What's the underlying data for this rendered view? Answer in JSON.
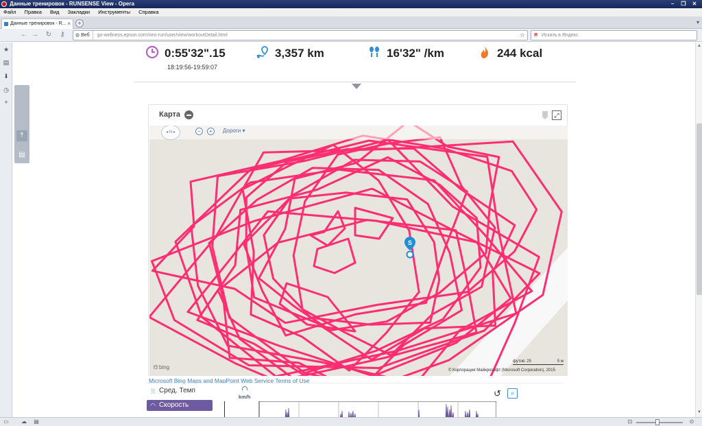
{
  "window": {
    "title": "Данные тренировок - RUNSENSE View - Opera",
    "controls": {
      "minimize": "–",
      "restore": "❐",
      "close": "✕"
    }
  },
  "menu": [
    "Файл",
    "Правка",
    "Вид",
    "Закладки",
    "Инструменты",
    "Справка"
  ],
  "tab": {
    "label": "Данные тренировок - R...",
    "close": "×",
    "new_tab": "+"
  },
  "address": {
    "site_label": "Веб",
    "url": "go-wellness.epson.com/neo-run/user/view/workoutDetail.html",
    "search_placeholder": "Искать в Яндекс",
    "search_engine": "Я"
  },
  "stats": {
    "time": "0:55'32\".15",
    "time_range": "18:19:56-19:59:07",
    "distance": "3,357 km",
    "pace": "16'32\" /km",
    "calories": "244 kcal"
  },
  "colors": {
    "time": "#b85fc6",
    "distance": "#2f8fd6",
    "pace": "#2f8fd6",
    "calories": "#f07a2a",
    "route": "#ff2d72",
    "accent": "#6d5aa0"
  },
  "map": {
    "title": "Карта",
    "compass": "N",
    "road_layer": "Дороги ▾",
    "bing": "bing",
    "copyright": "© Корпорация Майкрософт (Microsoft Corporation), 2015",
    "scale_left": "футов: 25",
    "scale_right": "5 м",
    "start_marker": "S",
    "terms": "Microsoft Bing Maps and MapPoint Web Service Terms of Use"
  },
  "chart_panel": {
    "options": [
      "Сред. Темп",
      "Скорость"
    ],
    "active_option": "Скорость",
    "unit": "km/h"
  }
}
